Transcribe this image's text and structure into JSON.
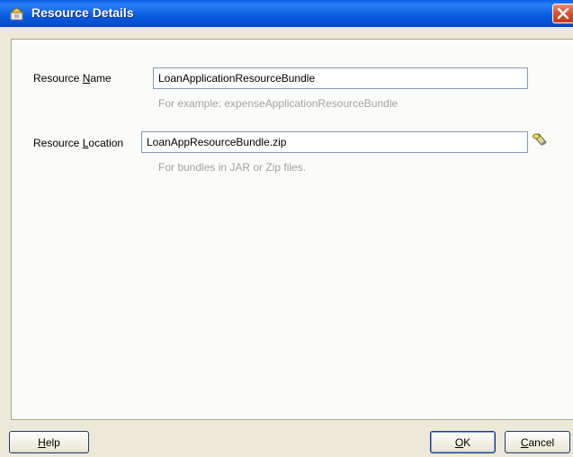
{
  "window": {
    "title": "Resource Details",
    "icon": "resource-bundle-icon",
    "close_icon": "close-icon"
  },
  "form": {
    "resource_name": {
      "label_prefix": "Resource ",
      "label_mnemonic": "N",
      "label_suffix": "ame",
      "value": "LoanApplicationResourceBundle",
      "hint": "For example: expenseApplicationResourceBundle"
    },
    "resource_location": {
      "label_prefix": "Resource ",
      "label_mnemonic": "L",
      "label_suffix": "ocation",
      "value": "LoanAppResourceBundle.zip",
      "hint": "For bundles in JAR or Zip files.",
      "browse_icon": "flashlight-browse-icon"
    }
  },
  "buttons": {
    "help": {
      "mnemonic": "H",
      "rest": "elp"
    },
    "ok": {
      "mnemonic": "O",
      "rest": "K"
    },
    "cancel": {
      "mnemonic": "C",
      "rest": "ancel"
    }
  },
  "colors": {
    "titlebar": "#0a5ee0",
    "close": "#d9522e",
    "dialog_bg": "#ece9d8",
    "hint_text": "#a3a3a3"
  }
}
